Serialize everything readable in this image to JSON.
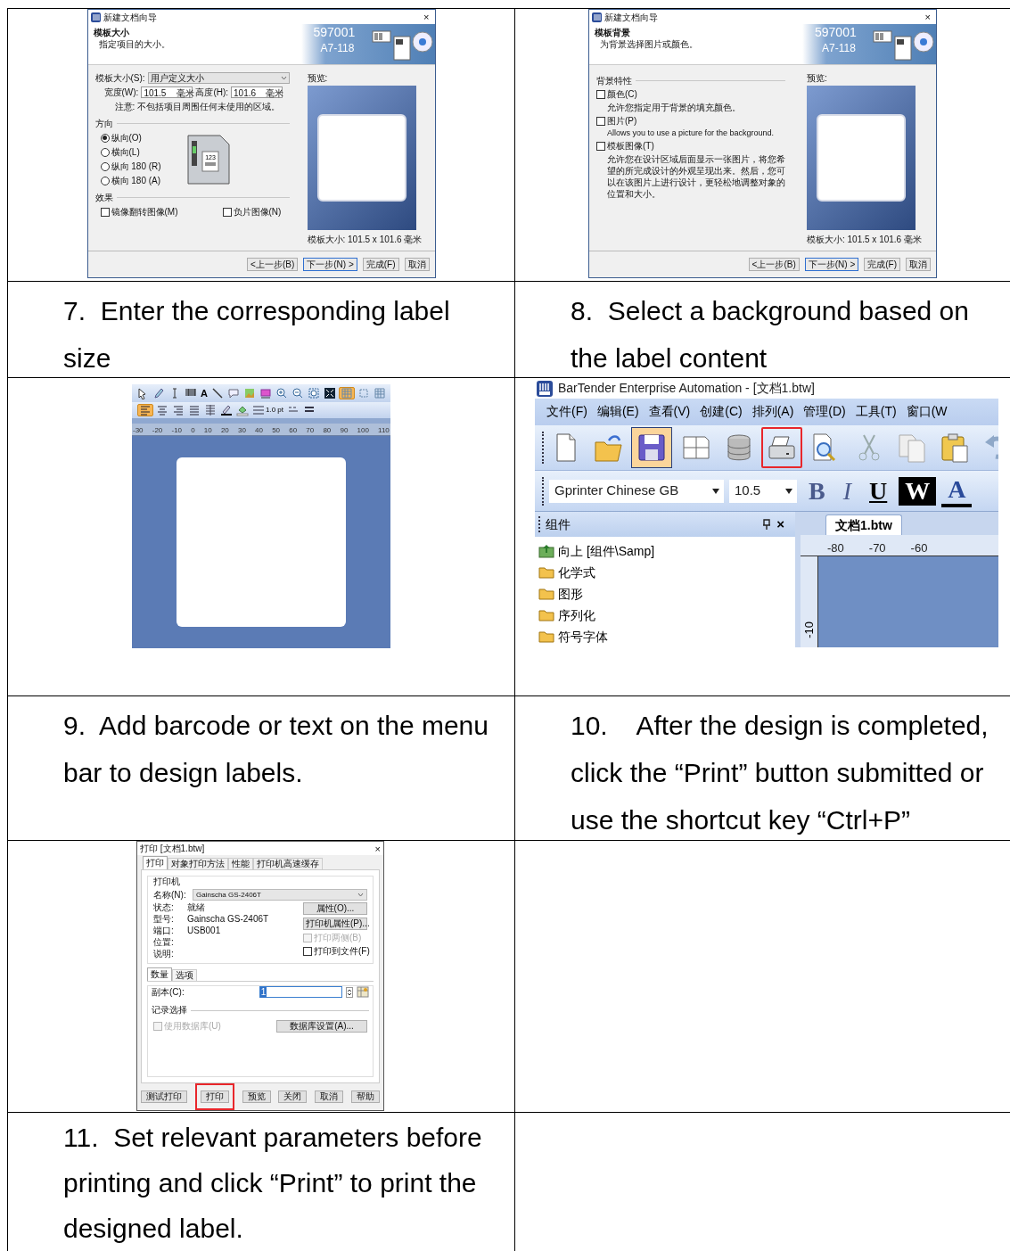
{
  "size_wizard": {
    "title": "新建文档向导",
    "close": "×",
    "heading": "模板大小",
    "subheading": "指定项目的大小。",
    "banner_texts": [
      "597001",
      "A7-118"
    ],
    "size_label": "模板大小(S):",
    "size_value": "用户定义大小",
    "width_label": "宽度(W):",
    "width_value": "101.5",
    "width_unit": "毫米",
    "height_label": "高度(H):",
    "height_value": "101.6",
    "height_unit": "毫米",
    "note": "注意: 不包括项目周围任何未使用的区域。",
    "orientation_group": "方向",
    "orientations": [
      {
        "label": "纵向(O)",
        "selected": true
      },
      {
        "label": "横向(L)",
        "selected": false
      },
      {
        "label": "纵向 180 (R)",
        "selected": false
      },
      {
        "label": "横向 180 (A)",
        "selected": false
      }
    ],
    "printer_label_text": "123",
    "effects_group": "效果",
    "effects": [
      {
        "label": "镜像翻转图像(M)",
        "checked": false
      },
      {
        "label": "负片图像(N)",
        "checked": false
      }
    ],
    "preview_label": "预览:",
    "preview_size": "模板大小: 101.5 x 101.6 毫米",
    "buttons": [
      {
        "label": "<上一步(B)",
        "default": false
      },
      {
        "label": "下一步(N) >",
        "default": true
      },
      {
        "label": "完成(F)",
        "default": false
      },
      {
        "label": "取消",
        "default": false
      }
    ]
  },
  "background_wizard": {
    "title": "新建文档向导",
    "close": "×",
    "heading": "模板背景",
    "subheading": "为背景选择图片或颜色。",
    "banner_texts": [
      "597001",
      "A7-118"
    ],
    "group": "背景特性",
    "options": [
      {
        "label": "颜色(C)",
        "checked": false,
        "description": "允许您指定用于背景的填充颜色。"
      },
      {
        "label": "图片(P)",
        "checked": false,
        "description": "Allows you to use a picture for the background."
      },
      {
        "label": "模板图像(T)",
        "checked": false,
        "description": "允许您在设计区域后面显示一张图片，将您希望的所完成设计的外观呈现出来。然后，您可以在该图片上进行设计，更轻松地调整对象的位置和大小。"
      }
    ],
    "preview_label": "预览:",
    "preview_size": "模板大小: 101.5 x 101.6 毫米",
    "buttons": [
      {
        "label": "<上一步(B)",
        "default": false
      },
      {
        "label": "下一步(N) >",
        "default": true
      },
      {
        "label": "完成(F)",
        "default": false
      },
      {
        "label": "取消",
        "default": false
      }
    ]
  },
  "steps": [
    "7.  Enter the corresponding label size",
    "8.  Select a background based on the label content",
    "9.  Add barcode or text on the menu bar to design labels.",
    "10.    After the design is completed, click the “Print” button submitted or use the shortcut key “Ctrl+P”",
    "11.  Set relevant parameters before printing and click “Print” to print the designed label."
  ],
  "designer": {
    "tools_row_1": [
      {
        "kind": "pointer",
        "selected": false
      },
      {
        "kind": "pen",
        "selected": false
      },
      {
        "kind": "ibeam",
        "selected": false
      },
      {
        "kind": "barcode",
        "selected": false
      },
      {
        "kind": "text",
        "label": "A",
        "selected": false
      },
      {
        "kind": "line",
        "selected": false
      },
      {
        "kind": "callout",
        "selected": false
      },
      {
        "kind": "picture",
        "selected": false
      },
      {
        "kind": "shape",
        "selected": false
      },
      {
        "kind": "zoom-in",
        "selected": false
      },
      {
        "kind": "zoom-out",
        "selected": false
      },
      {
        "kind": "zoom-fit",
        "selected": false
      },
      {
        "kind": "fullscreen",
        "selected": false
      },
      {
        "kind": "grid",
        "selected": true
      },
      {
        "kind": "align",
        "selected": false
      },
      {
        "kind": "grid",
        "selected": false
      }
    ],
    "tools_row_2": [
      {
        "kind": "align-left",
        "selected": true
      },
      {
        "kind": "align-center",
        "selected": false
      },
      {
        "kind": "align-right",
        "selected": false
      },
      {
        "kind": "justify",
        "selected": false
      },
      {
        "kind": "spacing",
        "selected": false
      },
      {
        "kind": "pen-color",
        "selected": false
      },
      {
        "kind": "fill-color",
        "selected": false
      },
      {
        "kind": "line-width",
        "label": "1.0 pt",
        "selected": false
      },
      {
        "kind": "dash",
        "selected": false
      },
      {
        "kind": "line-style",
        "selected": false
      }
    ],
    "ruler_labels": [
      "-30",
      "-20",
      "-10",
      "0",
      "10",
      "20",
      "30",
      "40",
      "50",
      "60",
      "70",
      "80",
      "90",
      "100",
      "110"
    ]
  },
  "bartender": {
    "title": "BarTender Enterprise Automation - [文档1.btw]",
    "menu": [
      "文件(F)",
      "编辑(E)",
      "查看(V)",
      "创建(C)",
      "排列(A)",
      "管理(D)",
      "工具(T)",
      "窗口(W"
    ],
    "tools": [
      {
        "kind": "new",
        "pressed": false,
        "highlighted": false
      },
      {
        "kind": "open",
        "pressed": false,
        "highlighted": false
      },
      {
        "kind": "save",
        "pressed": true,
        "highlighted": false
      },
      {
        "kind": "page-setup",
        "pressed": false,
        "highlighted": false
      },
      {
        "kind": "database",
        "pressed": false,
        "highlighted": false
      },
      {
        "kind": "print",
        "pressed": false,
        "highlighted": true
      },
      {
        "kind": "preview",
        "pressed": false,
        "highlighted": false
      },
      {
        "kind": "cut",
        "pressed": false,
        "highlighted": false
      },
      {
        "kind": "copy",
        "pressed": false,
        "highlighted": false
      },
      {
        "kind": "paste",
        "pressed": false,
        "highlighted": false
      },
      {
        "kind": "undo",
        "pressed": false,
        "highlighted": false
      }
    ],
    "font": "Gprinter Chinese GB",
    "font_size": "10.5",
    "format_buttons": [
      {
        "kind": "bold",
        "label": "B"
      },
      {
        "kind": "italic",
        "label": "I"
      },
      {
        "kind": "underline",
        "label": "U"
      },
      {
        "kind": "outline",
        "label": "W"
      },
      {
        "kind": "color",
        "label": "A"
      }
    ],
    "panel_title": "组件",
    "panel_close": "×",
    "components": [
      {
        "kind": "up",
        "label": "向上 [组件\\Samp]"
      },
      {
        "kind": "folder",
        "label": "化学式"
      },
      {
        "kind": "folder",
        "label": "图形"
      },
      {
        "kind": "folder",
        "label": "序列化"
      },
      {
        "kind": "folder",
        "label": "符号字体"
      }
    ],
    "document_tab": "文档1.btw",
    "ruler_labels": [
      "-80",
      "-70",
      "-60"
    ],
    "vertical_ruler_label": "-10"
  },
  "print_dialog": {
    "title": "打印 [文档1.btw]",
    "close": "×",
    "tabs": [
      {
        "label": "打印",
        "selected": true
      },
      {
        "label": "对象打印方法",
        "selected": false
      },
      {
        "label": "性能",
        "selected": false
      },
      {
        "label": "打印机高速缓存",
        "selected": false
      }
    ],
    "printer_group": "打印机",
    "name_label": "名称(N):",
    "name_value": "Gainscha GS-2406T",
    "info": [
      {
        "label": "状态:",
        "value": "就绪"
      },
      {
        "label": "型号:",
        "value": "Gainscha GS-2406T"
      },
      {
        "label": "端口:",
        "value": "USB001"
      },
      {
        "label": "位置:"
      },
      {
        "label": "说明:"
      }
    ],
    "properties_button": "属性(O)...",
    "printer_properties_button": "打印机属性(P)...",
    "checks": [
      {
        "label": "打印两侧(B)",
        "checked": false,
        "disabled": true
      },
      {
        "label": "打印到文件(F)",
        "checked": false,
        "disabled": false
      }
    ],
    "sub_tabs": [
      {
        "label": "数量",
        "selected": true
      },
      {
        "label": "选项",
        "selected": false
      }
    ],
    "copies_label": "副本(C):",
    "copies_value": "1",
    "records_group": "记录选择",
    "database_check": {
      "label": "使用数据库(U)",
      "checked": false,
      "disabled": true
    },
    "database_button": "数据库设置(A)...",
    "buttons": [
      {
        "label": "测试打印",
        "highlighted": false
      },
      {
        "label": "打印",
        "highlighted": true
      },
      {
        "label": "预览",
        "highlighted": false
      },
      {
        "label": "关闭",
        "highlighted": false
      },
      {
        "label": "取消",
        "highlighted": false
      },
      {
        "label": "帮助",
        "highlighted": false
      }
    ]
  }
}
